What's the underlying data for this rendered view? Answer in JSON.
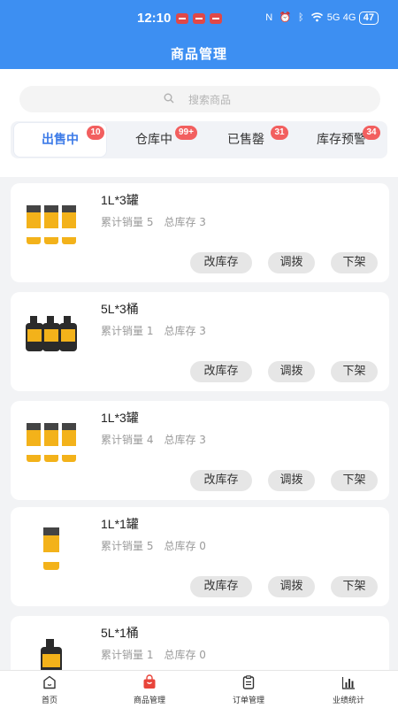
{
  "status_bar": {
    "time": "12:10",
    "network": "5G",
    "signal": "4G",
    "battery": "47"
  },
  "header": {
    "title": "商品管理"
  },
  "search": {
    "placeholder": "搜索商品"
  },
  "tabs": [
    {
      "label": "出售中",
      "badge": "10"
    },
    {
      "label": "仓库中",
      "badge": "99+"
    },
    {
      "label": "已售罄",
      "badge": "31"
    },
    {
      "label": "库存预警",
      "badge": "34"
    }
  ],
  "products": [
    {
      "name": "1L*3罐",
      "sales_label": "累计销量 5",
      "stock_label": "总库存 3",
      "image": "three-cans"
    },
    {
      "name": "5L*3桶",
      "sales_label": "累计销量 1",
      "stock_label": "总库存 3",
      "image": "three-buckets"
    },
    {
      "name": "1L*3罐",
      "sales_label": "累计销量 4",
      "stock_label": "总库存 3",
      "image": "three-cans"
    },
    {
      "name": "1L*1罐",
      "sales_label": "累计销量 5",
      "stock_label": "总库存 0",
      "image": "single-can"
    },
    {
      "name": "5L*1桶",
      "sales_label": "累计销量 1",
      "stock_label": "总库存 0",
      "image": "single-bucket"
    }
  ],
  "actions": {
    "change_stock": "改库存",
    "transfer": "调拨",
    "off_shelf": "下架"
  },
  "bottom_nav": [
    {
      "label": "首页",
      "icon": "home-icon"
    },
    {
      "label": "商品管理",
      "icon": "shopping-bag-icon"
    },
    {
      "label": "订单管理",
      "icon": "clipboard-icon"
    },
    {
      "label": "业绩统计",
      "icon": "bar-chart-icon"
    }
  ],
  "colors": {
    "primary": "#3d8ff2",
    "active_tab": "#3d7be8",
    "badge": "#f25f5f",
    "product_yellow": "#f3b21a",
    "nav_active": "#e8443a"
  }
}
